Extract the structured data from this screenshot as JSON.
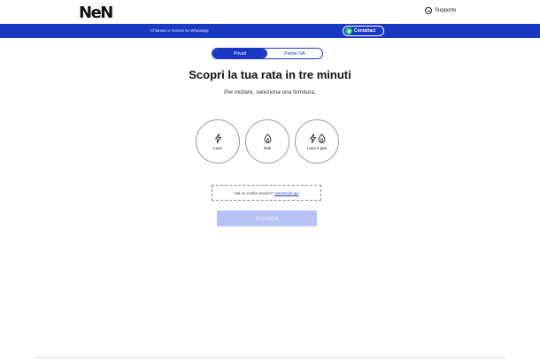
{
  "header": {
    "logo_text": "NeN",
    "support_label": "Supporto"
  },
  "banner": {
    "note": "Chiamaci o Scrivici su Whatsapp",
    "contact_label": "Contattaci"
  },
  "toggle": {
    "options": [
      "Privati",
      "Partite IVA"
    ],
    "selected": "Privati"
  },
  "main": {
    "title": "Scopri la tua rata in tre minuti",
    "subtitle": "Per iniziare, seleziona una fornitura."
  },
  "choices": [
    {
      "label": "Luce",
      "icons": [
        "lightning-icon"
      ]
    },
    {
      "label": "Gas",
      "icons": [
        "flame-icon"
      ]
    },
    {
      "label": "Luce e gas",
      "icons": [
        "lightning-icon",
        "flame-icon"
      ]
    }
  ],
  "promo": {
    "text": "Hai un codice promo?",
    "link": "Inseriscilo qui"
  },
  "proceed_label": "Prosegui",
  "colors": {
    "brand_blue": "#1939c4",
    "button_disabled": "#b7c3f4",
    "whatsapp_green": "#25d366"
  }
}
